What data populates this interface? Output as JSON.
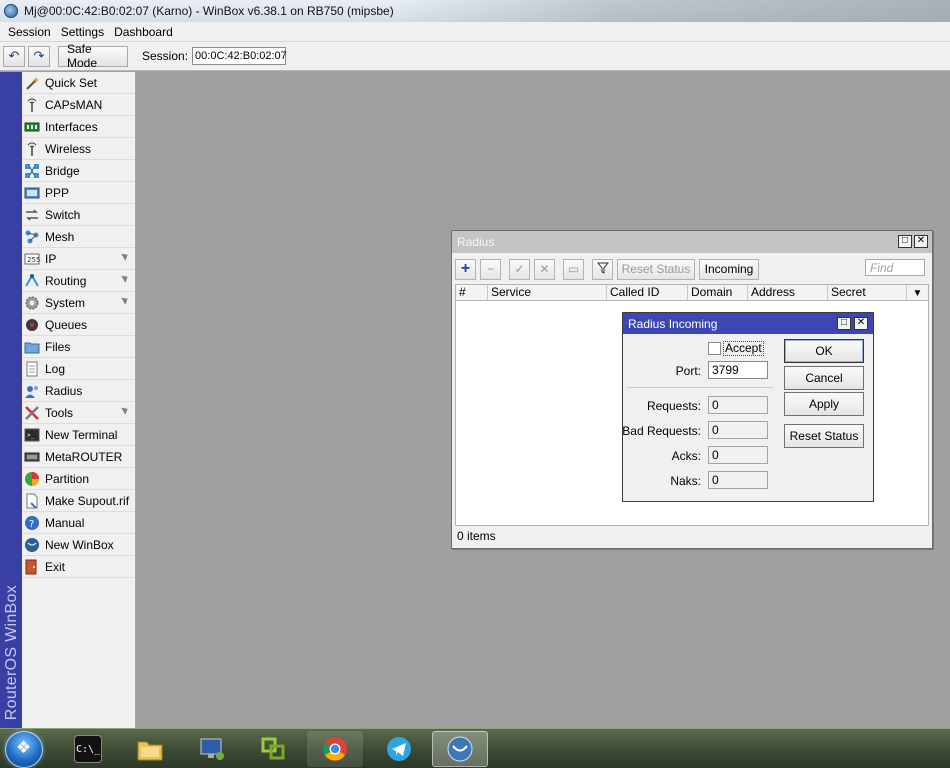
{
  "window": {
    "title": "Mj@00:0C:42:B0:02:07 (Karno) - WinBox v6.38.1 on RB750 (mipsbe)"
  },
  "menu": [
    "Session",
    "Settings",
    "Dashboard"
  ],
  "toolbar": {
    "undo_icon": "undo-icon",
    "redo_icon": "redo-icon",
    "safe_mode": "Safe Mode",
    "session_label": "Session:",
    "session_value": "00:0C:42:B0:02:07"
  },
  "brand": "RouterOS WinBox",
  "sidebar": {
    "items": [
      {
        "label": "Quick Set",
        "icon": "wand-icon",
        "submenu": false
      },
      {
        "label": "CAPsMAN",
        "icon": "antenna-icon",
        "submenu": false
      },
      {
        "label": "Interfaces",
        "icon": "interface-card-icon",
        "submenu": false
      },
      {
        "label": "Wireless",
        "icon": "antenna-icon",
        "submenu": false
      },
      {
        "label": "Bridge",
        "icon": "bridge-icon",
        "submenu": false
      },
      {
        "label": "PPP",
        "icon": "ppp-icon",
        "submenu": false
      },
      {
        "label": "Switch",
        "icon": "switch-icon",
        "submenu": false
      },
      {
        "label": "Mesh",
        "icon": "mesh-icon",
        "submenu": false
      },
      {
        "label": "IP",
        "icon": "ip-icon",
        "submenu": true
      },
      {
        "label": "Routing",
        "icon": "routing-icon",
        "submenu": true
      },
      {
        "label": "System",
        "icon": "gear-icon",
        "submenu": true
      },
      {
        "label": "Queues",
        "icon": "queue-icon",
        "submenu": false
      },
      {
        "label": "Files",
        "icon": "folder-icon",
        "submenu": false
      },
      {
        "label": "Log",
        "icon": "log-icon",
        "submenu": false
      },
      {
        "label": "Radius",
        "icon": "radius-icon",
        "submenu": false
      },
      {
        "label": "Tools",
        "icon": "tools-icon",
        "submenu": true
      },
      {
        "label": "New Terminal",
        "icon": "terminal-icon",
        "submenu": false
      },
      {
        "label": "MetaROUTER",
        "icon": "metarouter-icon",
        "submenu": false
      },
      {
        "label": "Partition",
        "icon": "pie-icon",
        "submenu": false
      },
      {
        "label": "Make Supout.rif",
        "icon": "document-icon",
        "submenu": false
      },
      {
        "label": "Manual",
        "icon": "help-icon",
        "submenu": false
      },
      {
        "label": "New WinBox",
        "icon": "winbox-icon",
        "submenu": false
      },
      {
        "label": "Exit",
        "icon": "exit-icon",
        "submenu": false
      }
    ]
  },
  "radius_window": {
    "title": "Radius",
    "toolbar": {
      "add_icon": "plus-icon",
      "remove_icon": "minus-icon",
      "enable_icon": "check-icon",
      "disable_icon": "cross-icon",
      "comment_icon": "comment-icon",
      "filter_icon": "filter-icon",
      "reset_status": "Reset Status",
      "incoming": "Incoming",
      "find_placeholder": "Find"
    },
    "columns": [
      "#",
      "Service",
      "Called ID",
      "Domain",
      "Address",
      "Secret"
    ],
    "status": "0 items"
  },
  "incoming_dialog": {
    "title": "Radius Incoming",
    "accept_label": "Accept",
    "accept_checked": false,
    "port_label": "Port:",
    "port_value": "3799",
    "requests_label": "Requests:",
    "requests_value": "0",
    "bad_requests_label": "Bad Requests:",
    "bad_requests_value": "0",
    "acks_label": "Acks:",
    "acks_value": "0",
    "naks_label": "Naks:",
    "naks_value": "0",
    "buttons": {
      "ok": "OK",
      "cancel": "Cancel",
      "apply": "Apply",
      "reset_status": "Reset Status"
    }
  },
  "taskbar": {
    "apps": [
      {
        "name": "cmd",
        "icon": "terminal-icon",
        "text": "C:\\_"
      },
      {
        "name": "explorer",
        "icon": "folder-icon"
      },
      {
        "name": "remote-desktop",
        "icon": "monitor-icon"
      },
      {
        "name": "vmware",
        "icon": "vmware-icon"
      },
      {
        "name": "chrome",
        "icon": "chrome-icon"
      },
      {
        "name": "telegram",
        "icon": "telegram-icon"
      },
      {
        "name": "winbox",
        "icon": "winbox-icon"
      }
    ]
  },
  "colors": {
    "brand_strip": "#3a3fa4",
    "dialog_title": "#3c47b4",
    "desktop": "#a0a0a0"
  }
}
